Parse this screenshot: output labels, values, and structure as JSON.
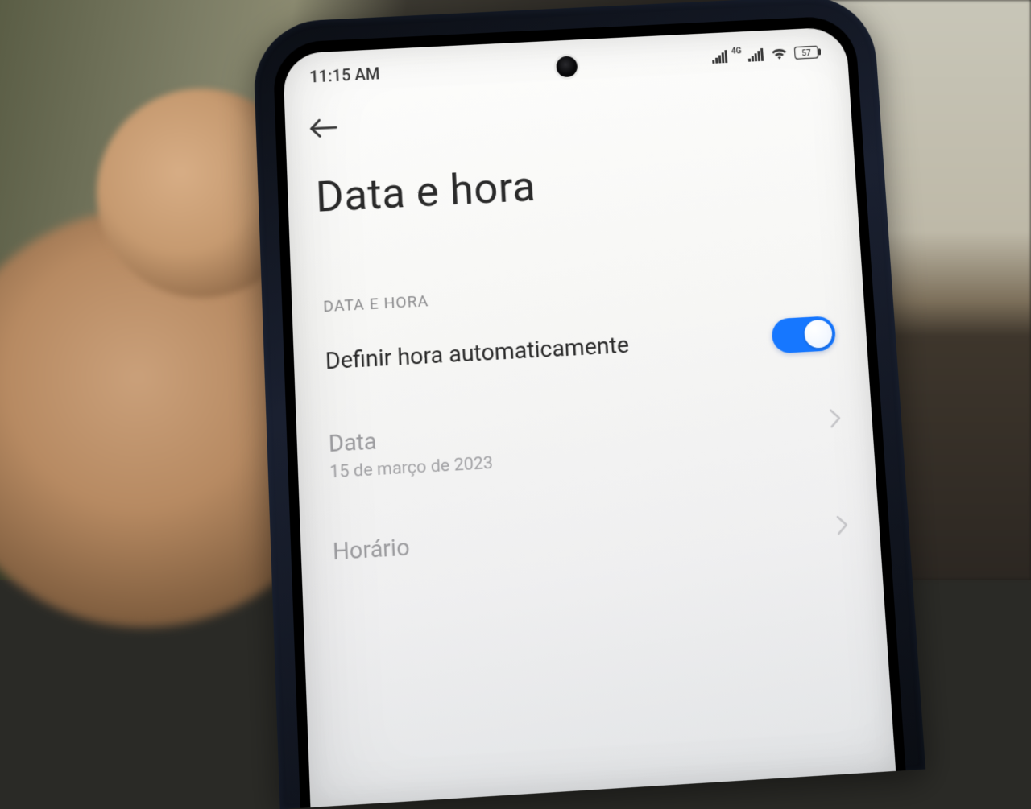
{
  "status_bar": {
    "time": "11:15 AM",
    "network_indicator": "4G",
    "battery_text": "57"
  },
  "page": {
    "title": "Data e hora"
  },
  "section": {
    "label": "DATA E HORA"
  },
  "rows": {
    "auto_time": {
      "label": "Definir hora automaticamente",
      "enabled": true
    },
    "date": {
      "label": "Data",
      "value": "15 de março de 2023"
    },
    "time": {
      "label": "Horário"
    }
  },
  "icons": {
    "back": "back-arrow",
    "signal1": "cellular-signal",
    "signal2": "cellular-signal-4g",
    "wifi": "wifi",
    "battery": "battery-57"
  },
  "colors": {
    "accent": "#1677ff",
    "text_primary": "#2a2a2a",
    "text_secondary": "#8d8d8f",
    "text_disabled": "#9c9c9f"
  }
}
